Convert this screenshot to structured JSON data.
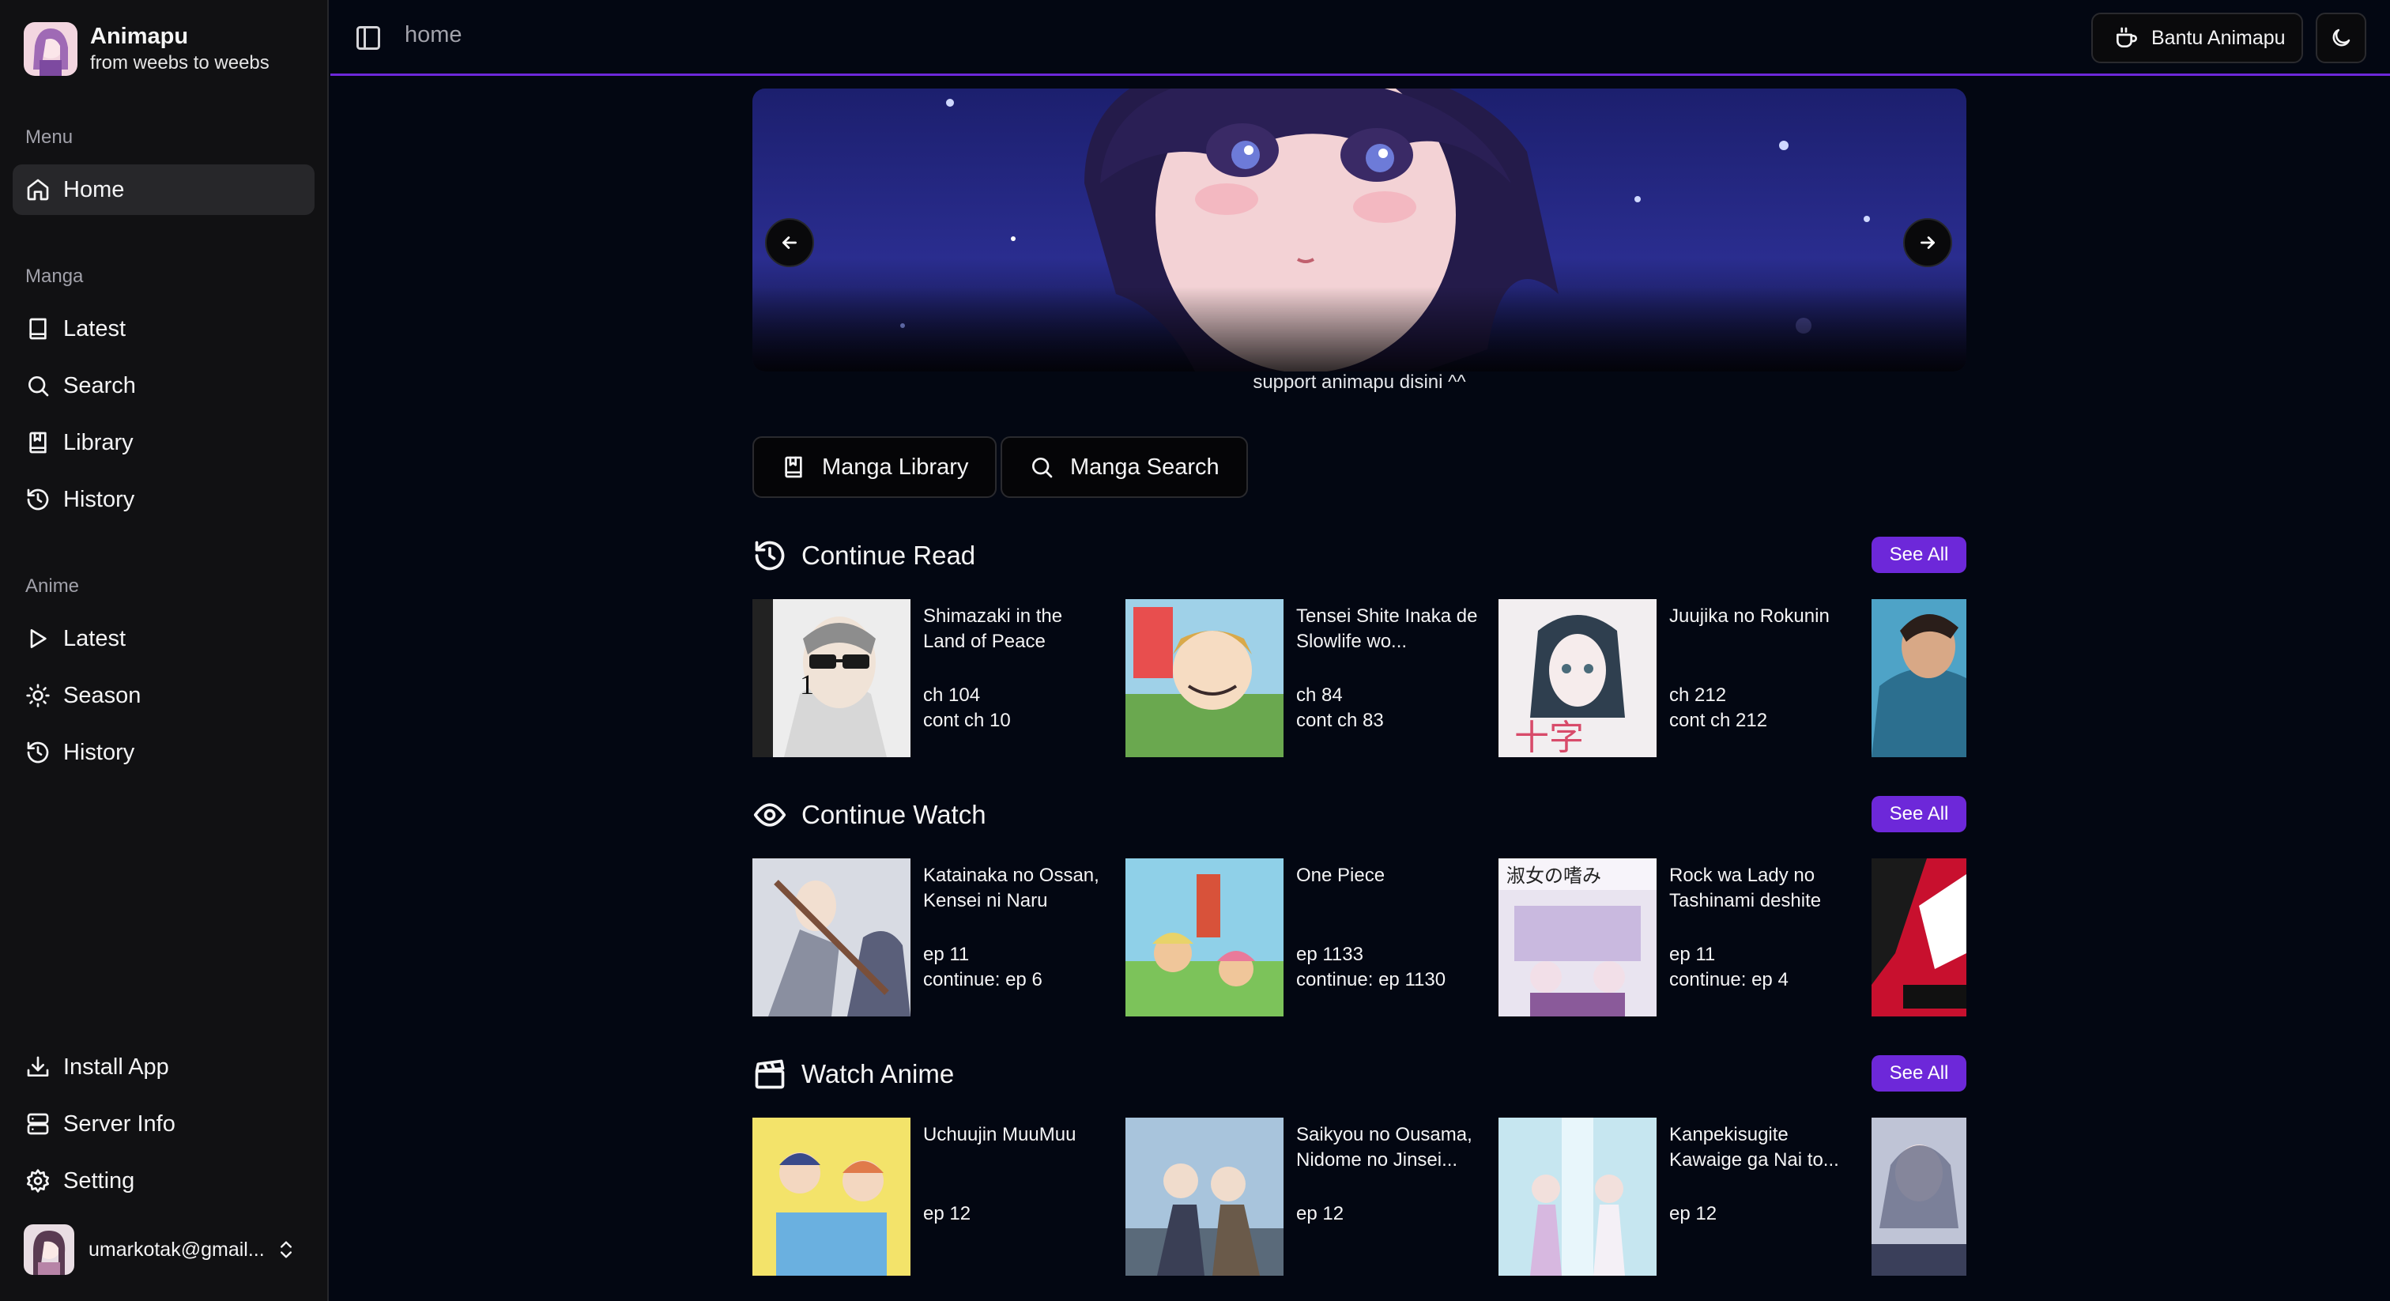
{
  "brand": {
    "title": "Animapu",
    "subtitle": "from weebs to weebs"
  },
  "sidebar": {
    "menu_label": "Menu",
    "home": "Home",
    "manga_label": "Manga",
    "manga_items": [
      "Latest",
      "Search",
      "Library",
      "History"
    ],
    "anime_label": "Anime",
    "anime_items": [
      "Latest",
      "Season",
      "History"
    ],
    "bottom_items": [
      "Install App",
      "Server Info",
      "Setting"
    ],
    "user_email": "umarkotak@gmail..."
  },
  "header": {
    "breadcrumb": "home",
    "support_label": "Bantu Animapu"
  },
  "banner": {
    "caption": "support animapu disini ^^"
  },
  "quick_actions": {
    "library": "Manga Library",
    "search": "Manga Search"
  },
  "continue_read": {
    "title": "Continue Read",
    "see_all": "See All",
    "items": [
      {
        "title": "Shimazaki in the Land of Peace",
        "line1": "ch 104",
        "line2": "cont ch 10"
      },
      {
        "title": "Tensei Shite Inaka de Slowlife wo...",
        "line1": "ch 84",
        "line2": "cont ch 83"
      },
      {
        "title": "Juujika no Rokunin",
        "line1": "ch 212",
        "line2": "cont ch 212"
      }
    ]
  },
  "continue_watch": {
    "title": "Continue Watch",
    "see_all": "See All",
    "items": [
      {
        "title": "Katainaka no Ossan, Kensei ni Naru",
        "line1": "ep 11",
        "line2": "continue: ep 6"
      },
      {
        "title": "One Piece",
        "line1": "ep 1133",
        "line2": "continue: ep 1130"
      },
      {
        "title": "Rock wa Lady no Tashinami deshite",
        "line1": "ep 11",
        "line2": "continue: ep 4"
      }
    ]
  },
  "watch_anime": {
    "title": "Watch Anime",
    "see_all": "See All",
    "items": [
      {
        "title": "Uchuujin MuuMuu",
        "line1": "ep 12"
      },
      {
        "title": "Saikyou no Ousama, Nidome no Jinsei...",
        "line1": "ep 12"
      },
      {
        "title": "Kanpekisugite Kawaige ga Nai to...",
        "line1": "ep 12"
      }
    ]
  },
  "colors": {
    "accent": "#6d28d9",
    "background": "#030712",
    "sidebar": "#111113"
  }
}
